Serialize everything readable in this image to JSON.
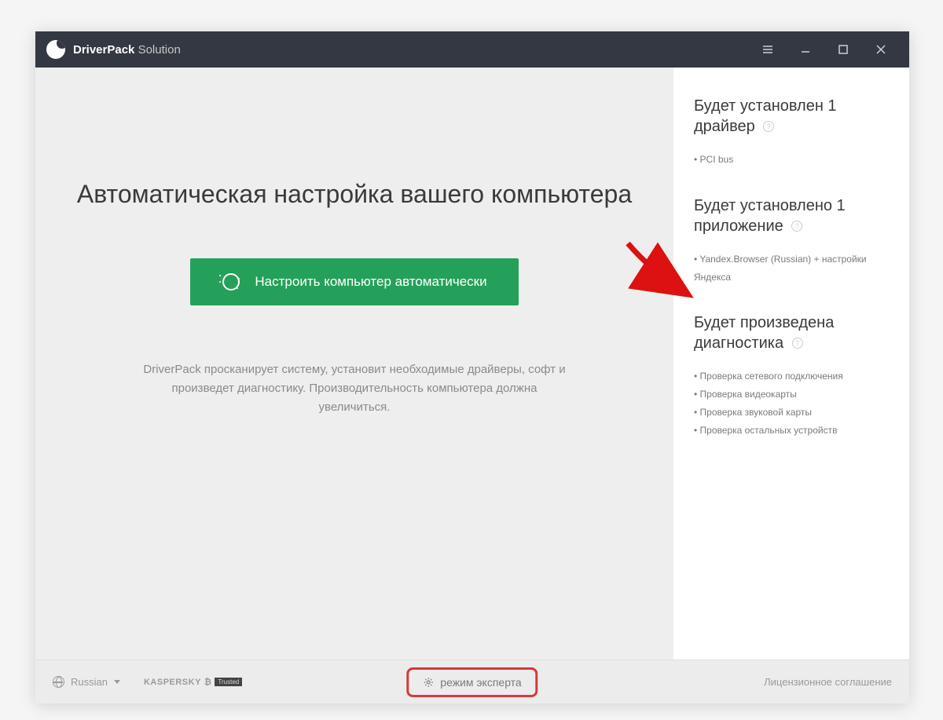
{
  "titlebar": {
    "brand_bold": "DriverPack",
    "brand_thin": "Solution"
  },
  "main": {
    "headline": "Автоматическая настройка вашего компьютера",
    "cta_label": "Настроить компьютер автоматически",
    "subtext": "DriverPack просканирует систему, установит необходимые драйверы, софт и произведет диагностику. Производительность компьютера должна увеличиться."
  },
  "sidebar": {
    "drivers": {
      "title": "Будет установлен 1 драйвер",
      "items": [
        "PCI bus"
      ]
    },
    "apps": {
      "title": "Будет установлено 1 приложение",
      "items": [
        "Yandex.Browser (Russian) + настройки Яндекса"
      ]
    },
    "diagnostics": {
      "title": "Будет произведена диагностика",
      "items": [
        "Проверка сетевого подключения",
        "Проверка видеокарты",
        "Проверка звуковой карты",
        "Проверка остальных устройств"
      ]
    }
  },
  "footer": {
    "language": "Russian",
    "antivirus_brand": "KASPERSKY",
    "antivirus_badge": "Trusted",
    "expert_mode": "режим эксперта",
    "license": "Лицензионное соглашение"
  }
}
